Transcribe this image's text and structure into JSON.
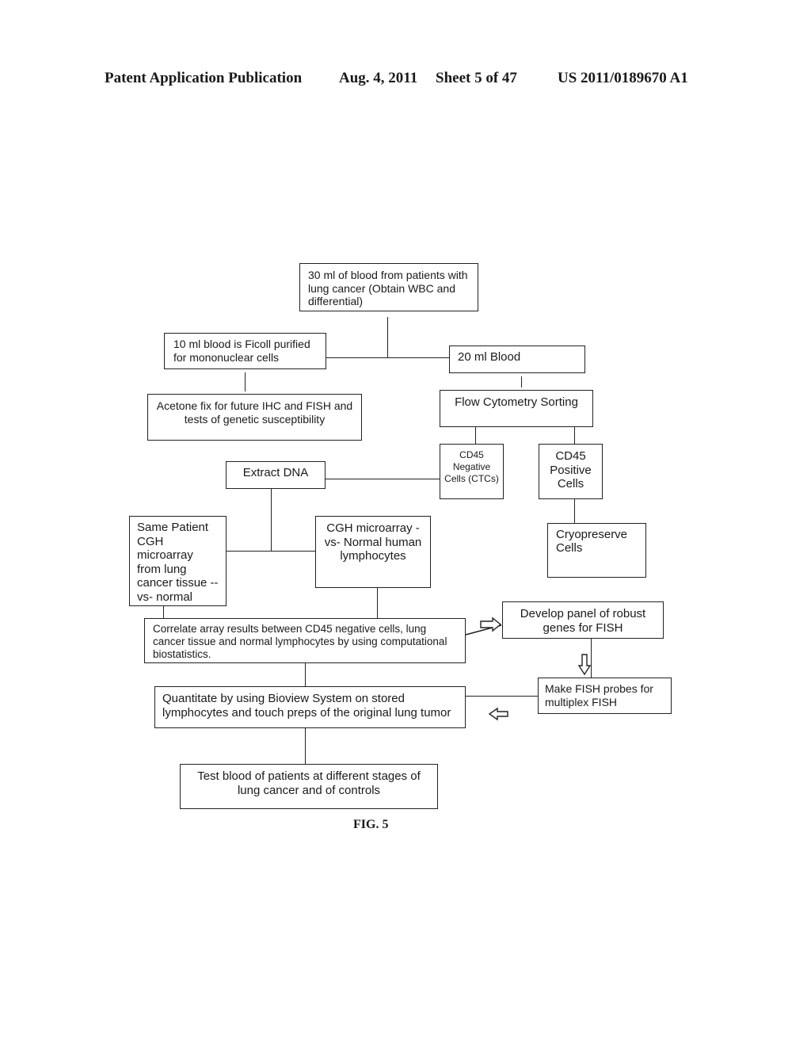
{
  "header": {
    "publication": "Patent Application Publication",
    "date": "Aug. 4, 2011",
    "sheet": "Sheet 5 of 47",
    "number": "US 2011/0189670 A1"
  },
  "flowchart": {
    "blood_30ml": "30 ml of blood from patients with lung cancer (Obtain WBC and differential)",
    "ficoll": "10 ml blood is Ficoll purified for mononuclear cells",
    "blood_20ml": "20 ml Blood",
    "acetone": "Acetone fix for future IHC and FISH and tests of genetic susceptibility",
    "flow_cytometry": "Flow Cytometry Sorting",
    "cd45_negative": "CD45 Negative Cells (CTCs)",
    "cd45_positive": "CD45 Positive Cells",
    "extract_dna": "Extract DNA",
    "cryopreserve": "Cryopreserve Cells",
    "same_patient_cgh": "Same Patient CGH microarray from lung cancer tissue -- vs- normal",
    "cgh_vs_normal": "CGH microarray -vs- Normal human lymphocytes",
    "correlate": "Correlate array results between CD45 negative cells, lung cancer tissue and normal lymphocytes by using computational biostatistics.",
    "develop_panel": "Develop panel of robust genes for FISH",
    "make_probes": "Make FISH probes for multiplex FISH",
    "quantitate": "Quantitate by using Bioview System on stored lymphocytes and touch preps of the original lung tumor",
    "test_blood": "Test blood of patients at different stages of lung cancer and of controls"
  },
  "figure_label": "FIG. 5"
}
